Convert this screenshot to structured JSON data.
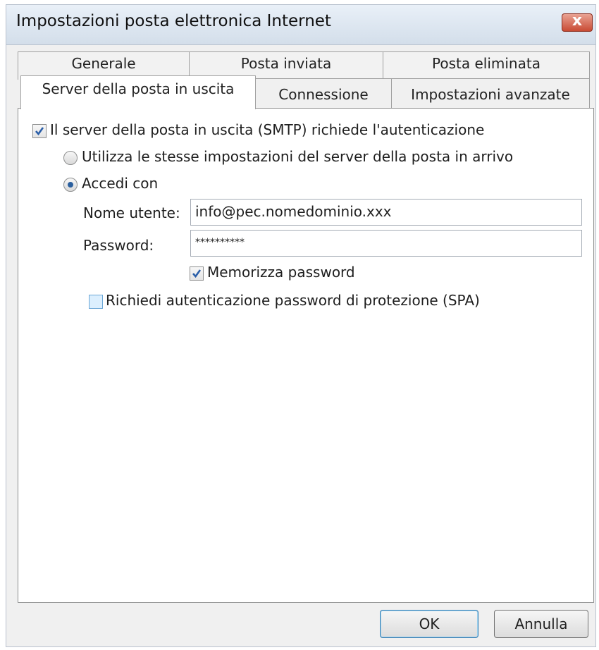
{
  "window": {
    "title": "Impostazioni posta elettronica Internet",
    "close_label": "x"
  },
  "tabs_row1": [
    {
      "label": "Generale"
    },
    {
      "label": "Posta inviata"
    },
    {
      "label": "Posta eliminata"
    }
  ],
  "tabs_row2": [
    {
      "label": "Server della posta in uscita",
      "active": true
    },
    {
      "label": "Connessione"
    },
    {
      "label": "Impostazioni avanzate"
    }
  ],
  "smtp": {
    "auth_required_label": "Il server della posta in uscita (SMTP) richiede l'autenticazione",
    "auth_required_checked": true,
    "same_settings_label": "Utilizza le stesse impostazioni del server della posta in arrivo",
    "same_settings_selected": false,
    "login_with_label": "Accedi con",
    "login_with_selected": true,
    "username_label": "Nome utente:",
    "username_value": "info@pec.nomedominio.xxx",
    "password_label": "Password:",
    "password_value": "**********",
    "remember_password_label": "Memorizza password",
    "remember_password_checked": true,
    "spa_label": "Richiedi autenticazione password di protezione (SPA)",
    "spa_checked": false
  },
  "footer": {
    "ok_label": "OK",
    "cancel_label": "Annulla"
  },
  "colors": {
    "annotation_arrow": "#e0141b",
    "check_mark": "#2a5ea8"
  }
}
